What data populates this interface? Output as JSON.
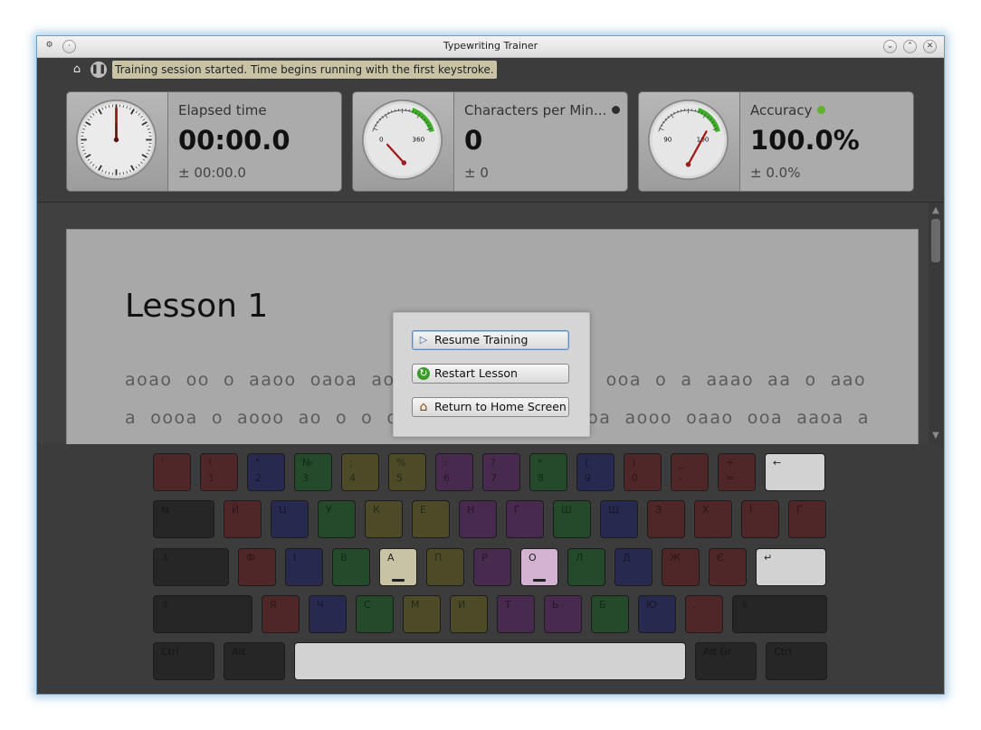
{
  "window": {
    "title": "Typewriting Trainer"
  },
  "toolbar": {
    "home_icon": "home-icon",
    "pause_icon": "pause-icon",
    "status": "Training session started. Time begins running with the first keystroke."
  },
  "stats": {
    "elapsed": {
      "title": "Elapsed time",
      "value": "00:00.0",
      "deviation": "± 00:00.0"
    },
    "cpm": {
      "title": "Characters per Min...",
      "value": "0",
      "deviation": "± 0",
      "gauge_min": "0",
      "gauge_max": "360",
      "indicator_color": "#2e2e2e"
    },
    "accuracy": {
      "title": "Accuracy",
      "value": "100.0%",
      "deviation": "± 0.0%",
      "gauge_min": "90",
      "gauge_max": "100",
      "indicator_color": "#5fb32c"
    }
  },
  "lesson": {
    "title": "Lesson 1",
    "lines": [
      "aoao  oo  o  aaoo  oaoa  aoao  aaa  ooa  oo  ao  ooa  o  a  aaao  aa  o  aao",
      "a  oooa  o  aooo  ao  o  o  o  a  oo  oo  aa  aa  oa  aooo  oaao  ooa  aaoa  a"
    ]
  },
  "dialog": {
    "resume": "Resume Training",
    "restart": "Restart Lesson",
    "home": "Return to Home Screen"
  },
  "keyboard": {
    "rows": [
      [
        {
          "top": "'",
          "bottom": "",
          "color": "red"
        },
        {
          "top": "!",
          "bottom": "1",
          "color": "red"
        },
        {
          "top": "\"",
          "bottom": "2",
          "color": "blue"
        },
        {
          "top": "№",
          "bottom": "3",
          "color": "green"
        },
        {
          "top": ";",
          "bottom": "4",
          "color": "olive"
        },
        {
          "top": "%",
          "bottom": "5",
          "color": "olive"
        },
        {
          "top": ":",
          "bottom": "6",
          "color": "purple"
        },
        {
          "top": "?",
          "bottom": "7",
          "color": "purple"
        },
        {
          "top": "*",
          "bottom": "8",
          "color": "green"
        },
        {
          "top": "(",
          "bottom": "9",
          "color": "blue"
        },
        {
          "top": ")",
          "bottom": "0",
          "color": "red"
        },
        {
          "top": "_",
          "bottom": "-",
          "color": "red"
        },
        {
          "top": "+",
          "bottom": "=",
          "color": "red"
        },
        {
          "top": "←",
          "bottom": "",
          "color": "light"
        }
      ],
      [
        {
          "top": "⇆",
          "bottom": "",
          "color": "dark"
        },
        {
          "top": "Й",
          "bottom": "",
          "color": "red"
        },
        {
          "top": "Ц",
          "bottom": "",
          "color": "blue"
        },
        {
          "top": "У",
          "bottom": "",
          "color": "green"
        },
        {
          "top": "К",
          "bottom": "",
          "color": "olive"
        },
        {
          "top": "Е",
          "bottom": "",
          "color": "olive"
        },
        {
          "top": "Н",
          "bottom": "",
          "color": "purple"
        },
        {
          "top": "Г",
          "bottom": "",
          "color": "purple"
        },
        {
          "top": "Ш",
          "bottom": "",
          "color": "green"
        },
        {
          "top": "Щ",
          "bottom": "",
          "color": "blue"
        },
        {
          "top": "З",
          "bottom": "",
          "color": "red"
        },
        {
          "top": "Х",
          "bottom": "",
          "color": "red"
        },
        {
          "top": "Ї",
          "bottom": "",
          "color": "red"
        },
        {
          "top": "Ґ",
          "bottom": "",
          "color": "red"
        }
      ],
      [
        {
          "top": "⇩",
          "bottom": "",
          "color": "dark"
        },
        {
          "top": "Ф",
          "bottom": "",
          "color": "red"
        },
        {
          "top": "І",
          "bottom": "",
          "color": "blue"
        },
        {
          "top": "В",
          "bottom": "",
          "color": "green"
        },
        {
          "top": "А",
          "bottom": "",
          "color": "hi-a"
        },
        {
          "top": "П",
          "bottom": "",
          "color": "olive"
        },
        {
          "top": "Р",
          "bottom": "",
          "color": "purple"
        },
        {
          "top": "О",
          "bottom": "",
          "color": "hi-o"
        },
        {
          "top": "Л",
          "bottom": "",
          "color": "green"
        },
        {
          "top": "Д",
          "bottom": "",
          "color": "blue"
        },
        {
          "top": "Ж",
          "bottom": "",
          "color": "red"
        },
        {
          "top": "Є",
          "bottom": "",
          "color": "red"
        },
        {
          "top": "↵",
          "bottom": "",
          "color": "light"
        }
      ],
      [
        {
          "top": "⇧",
          "bottom": "",
          "color": "dark"
        },
        {
          "top": "Я",
          "bottom": "",
          "color": "red"
        },
        {
          "top": "Ч",
          "bottom": "",
          "color": "blue"
        },
        {
          "top": "С",
          "bottom": "",
          "color": "green"
        },
        {
          "top": "М",
          "bottom": "",
          "color": "olive"
        },
        {
          "top": "И",
          "bottom": "",
          "color": "olive"
        },
        {
          "top": "Т",
          "bottom": "",
          "color": "purple"
        },
        {
          "top": "Ь",
          "bottom": "",
          "color": "purple"
        },
        {
          "top": "Б",
          "bottom": "",
          "color": "green"
        },
        {
          "top": "Ю",
          "bottom": "",
          "color": "blue"
        },
        {
          "top": ".",
          "bottom": "",
          "color": "red"
        },
        {
          "top": "⇧",
          "bottom": "",
          "color": "dark"
        }
      ],
      [
        {
          "top": "Ctrl",
          "bottom": "",
          "color": "dark"
        },
        {
          "top": "Alt",
          "bottom": "",
          "color": "dark"
        },
        {
          "top": "",
          "bottom": "",
          "color": "light"
        },
        {
          "top": "Alt Gr",
          "bottom": "",
          "color": "dark"
        },
        {
          "top": "Ctrl",
          "bottom": "",
          "color": "dark"
        }
      ]
    ]
  }
}
